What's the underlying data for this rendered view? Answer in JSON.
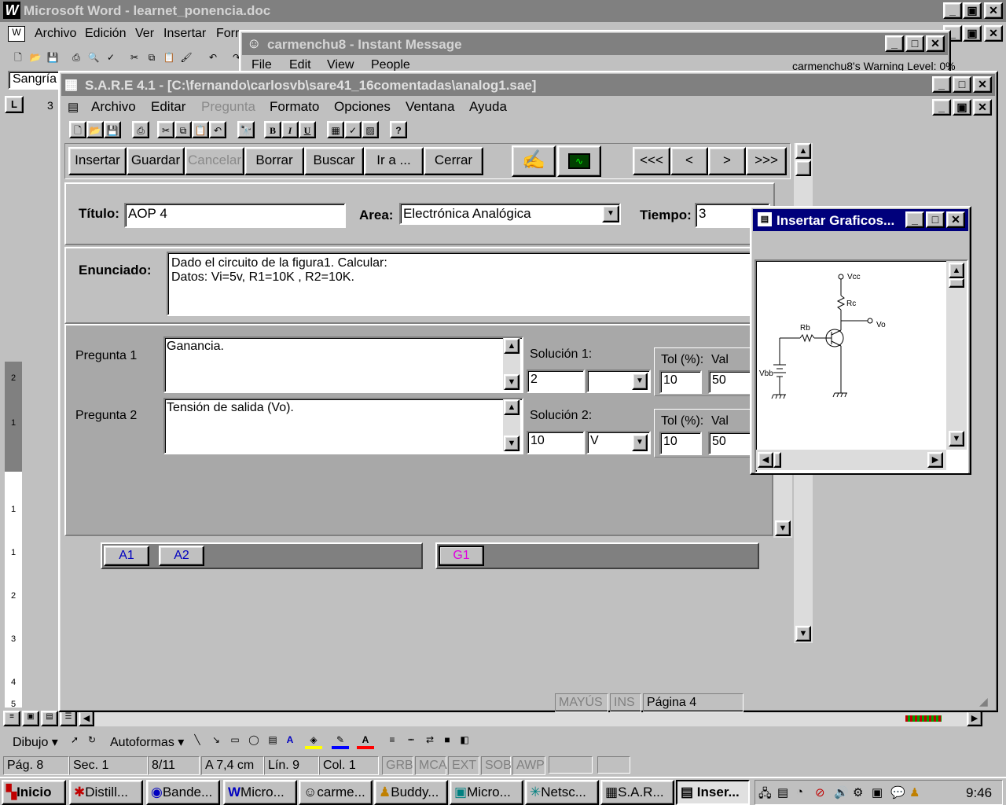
{
  "word": {
    "title": "Microsoft Word - learnet_ponencia.doc",
    "menu": [
      "Archivo",
      "Edición",
      "Ver",
      "Insertar",
      "Forr"
    ],
    "style_box": "Sangría",
    "ruler_tab": "L",
    "ruler_first": "3",
    "draw_toolbar": {
      "dibujo": "Dibujo",
      "autoformas": "Autoformas"
    },
    "status": {
      "pag": "Pág. 8",
      "sec": "Sec. 1",
      "pages": "8/11",
      "pos": "A 7,4 cm",
      "lin": "Lín. 9",
      "col": "Col. 1",
      "grb": "GRB",
      "mca": "MCA",
      "ext": "EXT",
      "sob": "SOB",
      "awp": "AWP"
    },
    "vruler_marks": [
      "2",
      "1",
      "1",
      "1",
      "2",
      "3",
      "4",
      "5"
    ]
  },
  "im": {
    "title": "carmenchu8 - Instant Message",
    "menu": [
      "File",
      "Edit",
      "View",
      "People"
    ],
    "warning": "carmenchu8's Warning Level: 0%"
  },
  "sare": {
    "title": "S.A.R.E 4.1 - [C:\\fernando\\carlosvb\\sare41_16comentadas\\analog1.sae]",
    "menu": [
      "Archivo",
      "Editar",
      "Pregunta",
      "Formato",
      "Opciones",
      "Ventana",
      "Ayuda"
    ],
    "toolbar_text": {
      "bold": "B",
      "italic": "I",
      "underline": "U",
      "help": "?"
    },
    "buttons": [
      "Insertar",
      "Guardar",
      "Cancelar",
      "Borrar",
      "Buscar",
      "Ir a ...",
      "Cerrar"
    ],
    "nav": [
      "<<<",
      "<",
      ">",
      ">>>"
    ],
    "titulo_label": "Título:",
    "titulo_value": "AOP 4",
    "area_label": "Area:",
    "area_value": "Electrónica Analógica",
    "tiempo_label": "Tiempo:",
    "tiempo_value": "3",
    "enunciado_label": "Enunciado:",
    "enunciado_line1": "Dado el circuito de la figura1. Calcular:",
    "enunciado_line2": "Datos: Vi=5v, R1=10K , R2=10K.",
    "q1": {
      "label": "Pregunta 1",
      "text": "Ganancia.",
      "sol_label": "Solución 1:",
      "sol_value": "2",
      "unit": "",
      "tol_label": "Tol (%):",
      "tol": "10",
      "val_label": "Val",
      "val": "50"
    },
    "q2": {
      "label": "Pregunta 2",
      "text": "Tensión de salida (Vo).",
      "sol_label": "Solución 2:",
      "sol_value": "10",
      "unit": "V",
      "tol_label": "Tol (%):",
      "tol": "10",
      "val_label": "Val",
      "val": "50"
    },
    "tabs_a": [
      "A1",
      "A2"
    ],
    "tab_g": "G1",
    "status": {
      "mayus": "MAYÚS",
      "ins": "INS",
      "pagina": "Página   4"
    }
  },
  "graficos": {
    "title": "Insertar Graficos...",
    "labels": {
      "vcc": "Vcc",
      "rc": "Rc",
      "vo": "Vo",
      "rb": "Rb",
      "vbb": "Vbb"
    }
  },
  "taskbar": {
    "start": "Inicio",
    "items": [
      "Distill...",
      "Bande...",
      "Micro...",
      "carme...",
      "Buddy...",
      "Micro...",
      "Netsc...",
      "S.A.R...",
      "Inser..."
    ],
    "time": "9:46"
  },
  "icons": {
    "word_logo": "word-logo-icon",
    "minimize": "minimize-icon",
    "maximize": "maximize-icon",
    "restore": "restore-icon",
    "close": "close-icon",
    "sare_logo": "sare-logo-icon"
  },
  "colors": {
    "active_title": "#00007b",
    "inactive_title": "#808080",
    "face": "#c0c0c0",
    "desk_panel": "#a8a8a8",
    "tab_text": "#0000c0",
    "tab_g_text": "#e000e0"
  }
}
